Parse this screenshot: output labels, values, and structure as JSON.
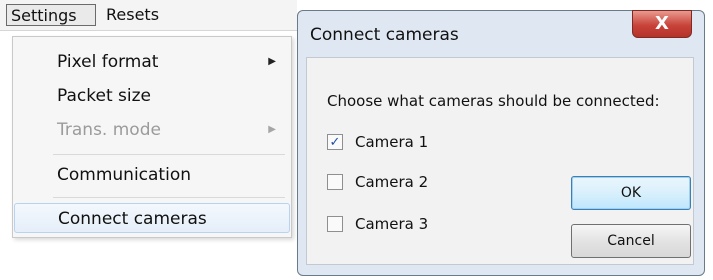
{
  "menubar": {
    "items": [
      "Settings",
      "Resets"
    ]
  },
  "dropdown": {
    "items": [
      {
        "label": "Pixel format",
        "submenu": true,
        "disabled": false
      },
      {
        "label": "Packet size",
        "submenu": false,
        "disabled": false
      },
      {
        "label": "Trans. mode",
        "submenu": true,
        "disabled": true
      },
      {
        "label": "Communication",
        "submenu": false,
        "disabled": false
      },
      {
        "label": "Connect cameras",
        "submenu": false,
        "disabled": false,
        "highlighted": true
      }
    ],
    "submenu_arrow": "▶"
  },
  "dialog": {
    "title": "Connect cameras",
    "close_label": "X",
    "prompt": "Choose what cameras should be connected:",
    "cameras": [
      {
        "label": "Camera 1",
        "checked": true
      },
      {
        "label": "Camera 2",
        "checked": false
      },
      {
        "label": "Camera 3",
        "checked": false
      }
    ],
    "check_mark": "✓",
    "ok_label": "OK",
    "cancel_label": "Cancel"
  },
  "colors": {
    "close_button": "#c8433a",
    "highlight": "#e5eef9",
    "check_mark": "#1f4ea3"
  }
}
